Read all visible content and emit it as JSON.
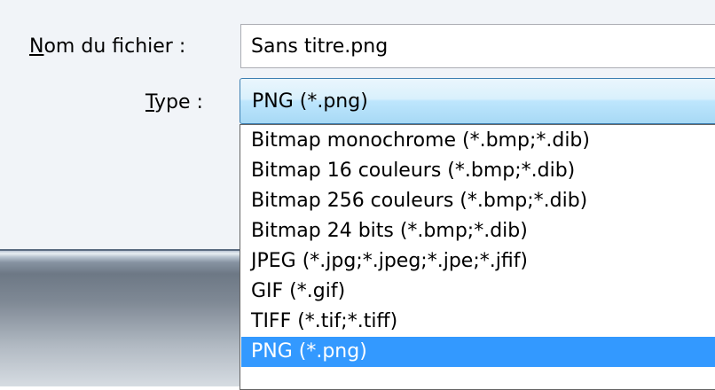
{
  "dialog": {
    "filename_label": "Nom du fichier :",
    "filename_value": "Sans titre.png",
    "type_label": "Type :",
    "type_value": "PNG (*.png)"
  },
  "type_options": [
    {
      "label": "Bitmap monochrome (*.bmp;*.dib)",
      "selected": false
    },
    {
      "label": "Bitmap 16 couleurs (*.bmp;*.dib)",
      "selected": false
    },
    {
      "label": "Bitmap 256 couleurs (*.bmp;*.dib)",
      "selected": false
    },
    {
      "label": "Bitmap 24 bits (*.bmp;*.dib)",
      "selected": false
    },
    {
      "label": "JPEG (*.jpg;*.jpeg;*.jpe;*.jfif)",
      "selected": false
    },
    {
      "label": "GIF (*.gif)",
      "selected": false
    },
    {
      "label": "TIFF (*.tif;*.tiff)",
      "selected": false
    },
    {
      "label": "PNG (*.png)",
      "selected": true
    }
  ],
  "colors": {
    "selection_highlight": "#3399ff",
    "select_border": "#3c7fb1",
    "dialog_background": "#f1f4f8"
  }
}
